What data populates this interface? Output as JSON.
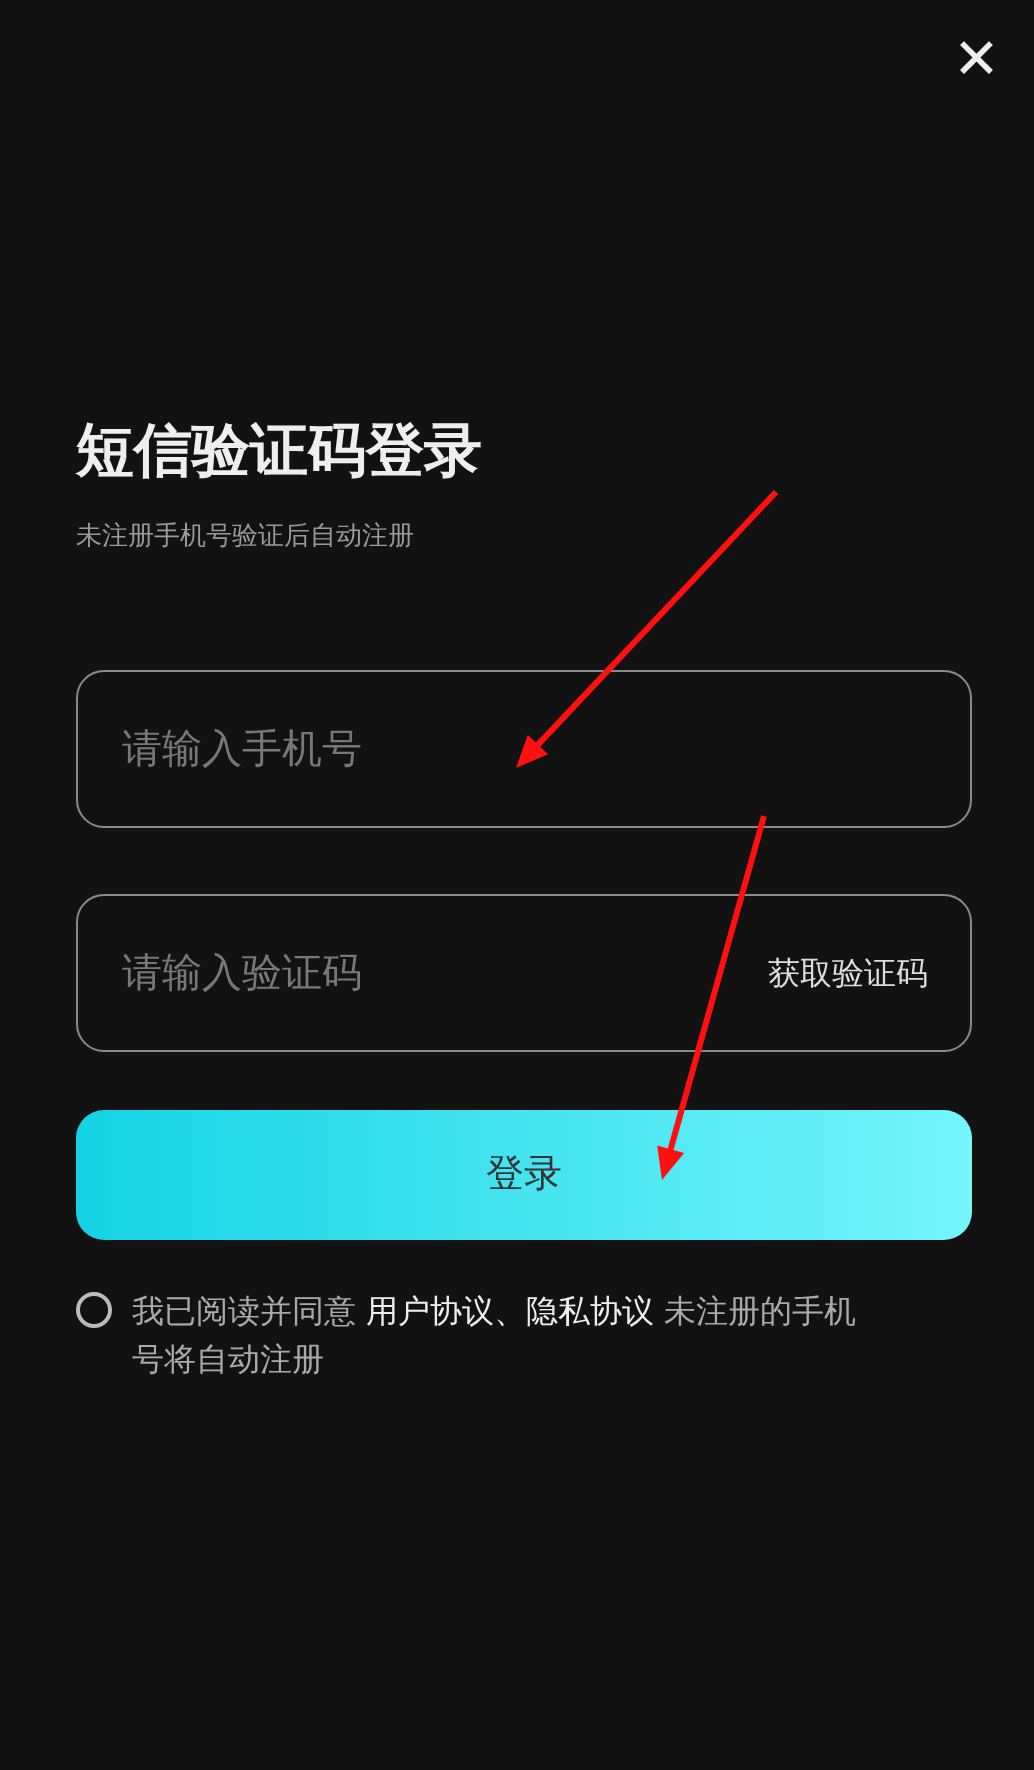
{
  "close_button": {
    "label": "✕"
  },
  "title": "短信验证码登录",
  "subtitle": "未注册手机号验证后自动注册",
  "phone_field": {
    "placeholder": "请输入手机号"
  },
  "code_field": {
    "placeholder": "请输入验证码",
    "action": "获取验证码"
  },
  "login_button": "登录",
  "agreement": {
    "checked": false,
    "before": "我已阅读并同意 ",
    "link": "用户协议、隐私协议",
    "after": " 未注册的手机号将自动注册"
  }
}
